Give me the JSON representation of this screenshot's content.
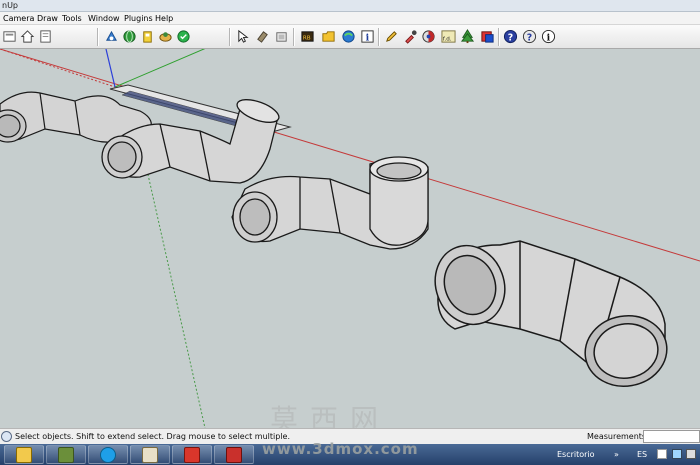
{
  "window": {
    "title_fragment": "nUp"
  },
  "menu": [
    "Camera",
    "Draw",
    "Tools",
    "Window",
    "Plugins",
    "Help"
  ],
  "toolbar": {
    "icons": [
      "new-icon",
      "home-icon",
      "open-icon",
      "component-icon",
      "globe-icon",
      "warehouse-icon",
      "sandbox-icon",
      "geo-icon",
      "select-icon",
      "paint-icon",
      "eraser-icon",
      "ruby-icon",
      "folder-icon",
      "globe-share-icon",
      "info-icon",
      "pencil-icon",
      "dropper-icon",
      "shadow-icon",
      "fd-icon",
      "tree-icon",
      "export-icon",
      "help-icon",
      "help2-icon",
      "info2-icon"
    ],
    "fd_label": "f.d."
  },
  "status": {
    "message": "Select objects. Shift to extend select. Drag mouse to select multiple.",
    "measurements_label": "Measurements",
    "measurements_value": ""
  },
  "watermark": {
    "chars": "莫西网",
    "url": "www.3dmox.com"
  },
  "taskbar": {
    "apps": [
      "explorer",
      "minecraft",
      "skype",
      "paint",
      "sketchup",
      "sketchup-2"
    ],
    "desktop_label": "Escritorio",
    "language": "ES"
  },
  "colors": {
    "viewport_bg": "#c6cece",
    "axis_red": "#c43a3a",
    "axis_green": "#2fa02f",
    "axis_blue": "#2b3fd9",
    "pipe_fill": "#d6d6d6",
    "pipe_edge": "#1a1a1a"
  }
}
